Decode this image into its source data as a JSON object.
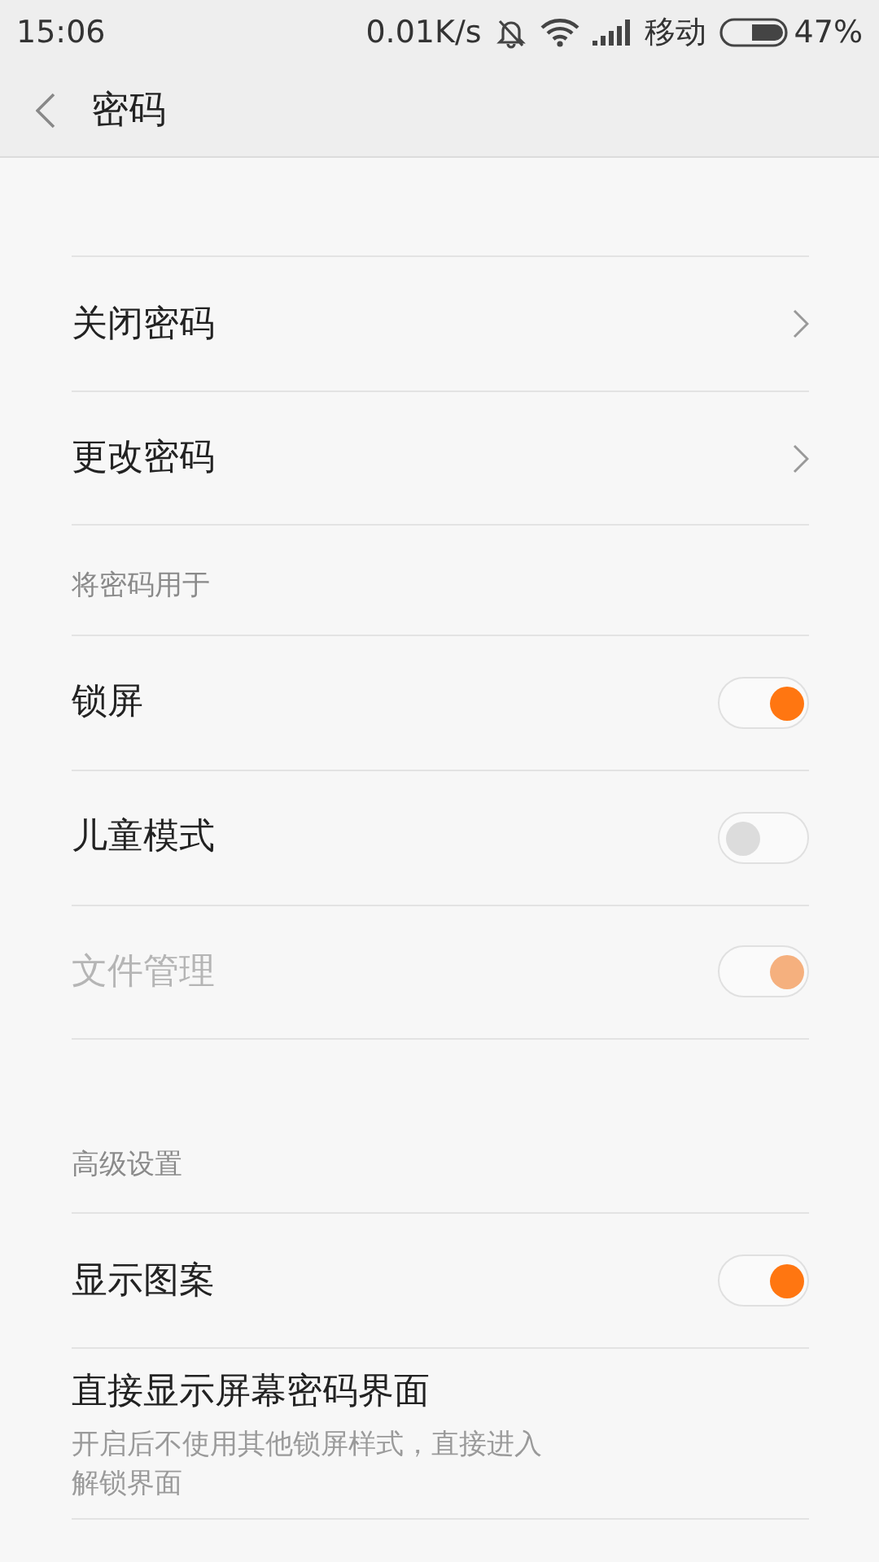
{
  "status_bar": {
    "time": "15:06",
    "speed": "0.01K/s",
    "carrier": "移动",
    "battery": "47%"
  },
  "header": {
    "title": "密码"
  },
  "sections": [
    {
      "items": [
        {
          "kind": "nav",
          "label": "关闭密码"
        },
        {
          "kind": "nav",
          "label": "更改密码"
        }
      ]
    },
    {
      "title": "将密码用于",
      "items": [
        {
          "kind": "toggle",
          "label": "锁屏",
          "on": true,
          "disabled": false
        },
        {
          "kind": "toggle",
          "label": "儿童模式",
          "on": false,
          "disabled": false
        },
        {
          "kind": "toggle",
          "label": "文件管理",
          "on": true,
          "disabled": true
        }
      ]
    },
    {
      "title": "高级设置",
      "items": [
        {
          "kind": "toggle",
          "label": "显示图案",
          "on": true,
          "disabled": false
        },
        {
          "kind": "text",
          "label": "直接显示屏幕密码界面",
          "description": [
            "开启后不使用其他锁屏样式，直接进入",
            "解锁界面"
          ]
        }
      ]
    }
  ]
}
